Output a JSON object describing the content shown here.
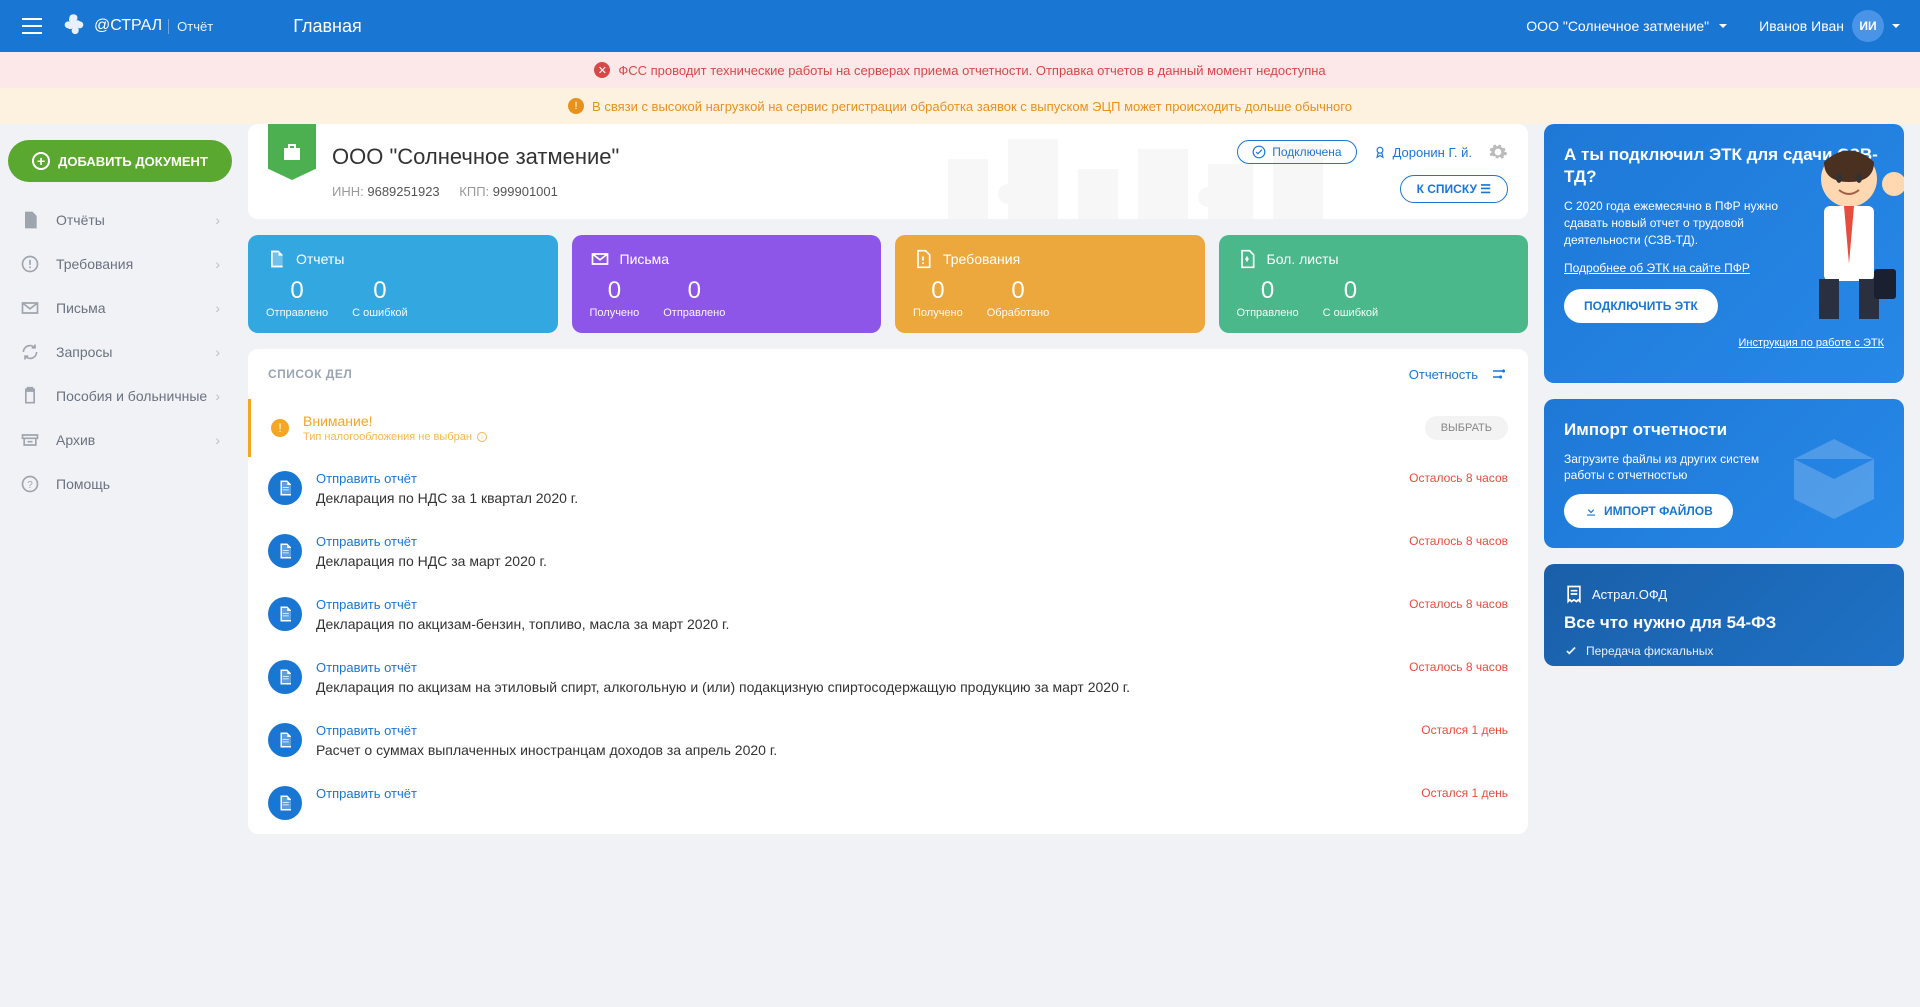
{
  "header": {
    "brand": "@СТРАЛ",
    "brand_sub": "Отчёт",
    "page_title": "Главная",
    "org": "ООО \"Солнечное затмение\"",
    "user": "Иванов Иван",
    "avatar_initials": "ИИ"
  },
  "alerts": {
    "error": "ФСС проводит технические работы на серверах приема отчетности. Отправка отчетов в данный момент недоступна",
    "warn": "В связи с высокой нагрузкой на сервис регистрации обработка заявок с выпуском ЭЦП может происходить дольше обычного"
  },
  "sidebar": {
    "add_btn": "ДОБАВИТЬ ДОКУМЕНТ",
    "items": [
      {
        "label": "Отчёты"
      },
      {
        "label": "Требования"
      },
      {
        "label": "Письма"
      },
      {
        "label": "Запросы"
      },
      {
        "label": "Пособия и больничные"
      },
      {
        "label": "Архив"
      },
      {
        "label": "Помощь"
      }
    ]
  },
  "org_card": {
    "name": "ООО \"Солнечное затмение\"",
    "inn_label": "ИНН:",
    "inn": "9689251923",
    "kpp_label": "КПП:",
    "kpp": "999901001",
    "connected": "Подключена",
    "person": "Доронин Г. й.",
    "to_list": "К СПИСКУ ☰"
  },
  "stats": [
    {
      "title": "Отчеты",
      "v1": "0",
      "l1": "Отправлено",
      "v2": "0",
      "l2": "С ошибкой"
    },
    {
      "title": "Письма",
      "v1": "0",
      "l1": "Получено",
      "v2": "0",
      "l2": "Отправлено"
    },
    {
      "title": "Требования",
      "v1": "0",
      "l1": "Получено",
      "v2": "0",
      "l2": "Обработано"
    },
    {
      "title": "Бол. листы",
      "v1": "0",
      "l1": "Отправлено",
      "v2": "0",
      "l2": "С ошибкой"
    }
  ],
  "todo": {
    "title": "СПИСОК ДЕЛ",
    "filter": "Отчетность",
    "warn_title": "Внимание!",
    "warn_sub": "Тип налогообложения не выбран",
    "warn_btn": "ВЫБРАТЬ",
    "items": [
      {
        "action": "Отправить отчёт",
        "desc": "Декларация по НДС за 1 квартал 2020 г.",
        "time": "Осталось 8 часов"
      },
      {
        "action": "Отправить отчёт",
        "desc": "Декларация по НДС за март 2020 г.",
        "time": "Осталось 8 часов"
      },
      {
        "action": "Отправить отчёт",
        "desc": "Декларация по акцизам-бензин, топливо, масла за март 2020 г.",
        "time": "Осталось 8 часов"
      },
      {
        "action": "Отправить отчёт",
        "desc": "Декларация по акцизам на этиловый спирт, алкогольную и (или) подакцизную спиртосодержащую продукцию за март 2020 г.",
        "time": "Осталось 8 часов"
      },
      {
        "action": "Отправить отчёт",
        "desc": "Расчет о суммах выплаченных иностранцам доходов за апрель 2020 г.",
        "time": "Остался 1 день"
      },
      {
        "action": "Отправить отчёт",
        "desc": "",
        "time": "Остался 1 день"
      }
    ]
  },
  "right": {
    "etk": {
      "title": "А ты подключил ЭТК для сдачи СЗВ-ТД?",
      "body": "С 2020 года ежемесячно в ПФР нужно сдавать новый отчет о трудовой деятельности (СЗВ-ТД).",
      "link": "Подробнее об ЭТК на сайте ПФР",
      "btn": "ПОДКЛЮЧИТЬ ЭТК",
      "inst": "Инструкция по работе с ЭТК"
    },
    "import": {
      "title": "Импорт отчетности",
      "body": "Загрузите файлы из других систем работы с отчетностью",
      "btn": "ИМПОРТ ФАЙЛОВ"
    },
    "ofd": {
      "brand": "Астрал.ОФД",
      "title": "Все что нужно для 54-ФЗ",
      "sub": "Передача фискальных"
    }
  }
}
